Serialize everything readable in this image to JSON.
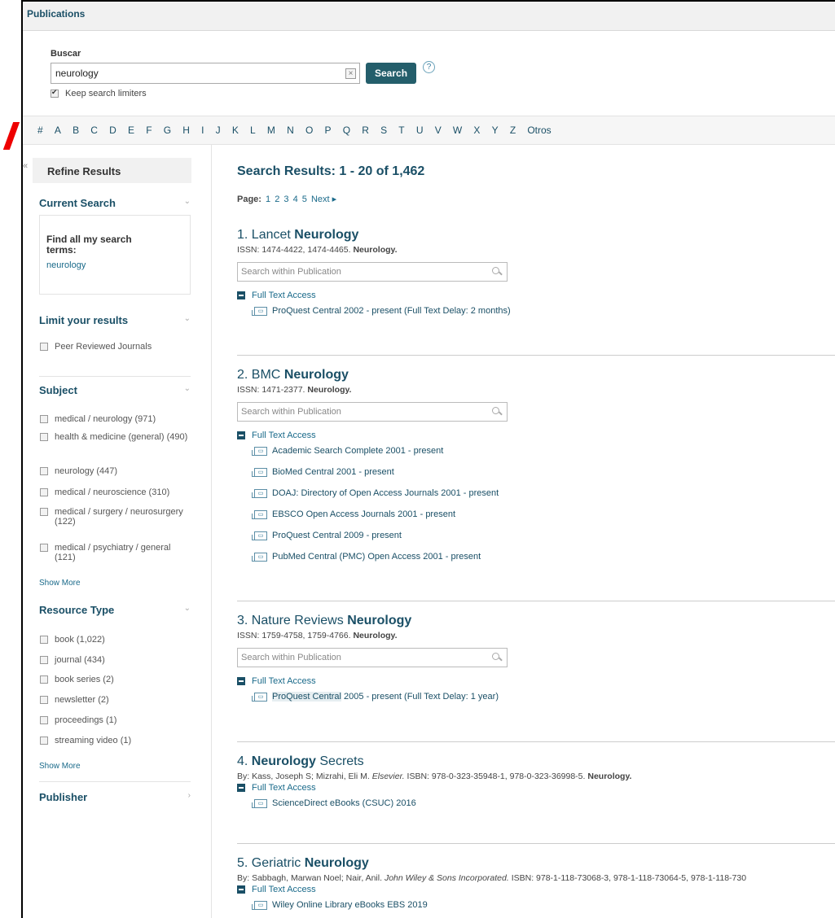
{
  "topbar": {
    "title": "Publications"
  },
  "search": {
    "label": "Buscar",
    "value": "neurology",
    "clear_glyph": "×",
    "button": "Search",
    "help": "?",
    "keep_limiters": "Keep search limiters"
  },
  "alphabet": [
    "#",
    "A",
    "B",
    "C",
    "D",
    "E",
    "F",
    "G",
    "H",
    "I",
    "J",
    "K",
    "L",
    "M",
    "N",
    "O",
    "P",
    "Q",
    "R",
    "S",
    "T",
    "U",
    "V",
    "W",
    "X",
    "Y",
    "Z",
    "Otros"
  ],
  "sidebar": {
    "collapse_glyph": "«",
    "refine_title": "Refine Results",
    "current_search": {
      "title": "Current Search",
      "box_title": "Find all my search terms:",
      "box_value": "neurology"
    },
    "limit": {
      "title": "Limit your results",
      "items": [
        "Peer Reviewed Journals"
      ]
    },
    "subject": {
      "title": "Subject",
      "items": [
        {
          "label": "medical / neurology (971)"
        },
        {
          "label": "health & medicine (general) (490)"
        },
        {
          "label": "neurology (447)"
        },
        {
          "label": "medical / neuroscience (310)"
        },
        {
          "label": "medical / surgery / neurosurgery (122)"
        },
        {
          "label": "medical / psychiatry / general (121)"
        }
      ],
      "show_more": "Show More"
    },
    "resource_type": {
      "title": "Resource Type",
      "items": [
        {
          "label": "book (1,022)"
        },
        {
          "label": "journal (434)"
        },
        {
          "label": "book series (2)"
        },
        {
          "label": "newsletter (2)"
        },
        {
          "label": "proceedings (1)"
        },
        {
          "label": "streaming video (1)"
        }
      ],
      "show_more": "Show More"
    },
    "publisher": {
      "title": "Publisher"
    }
  },
  "main": {
    "results_title": "Search Results: 1 - 20 of 1,462",
    "paging": {
      "label": "Page:",
      "pages": [
        "1",
        "2",
        "3",
        "4",
        "5"
      ],
      "next": "Next ▸"
    },
    "search_within_placeholder": "Search within Publication",
    "full_text_access": "Full Text Access",
    "results": [
      {
        "num": "1.",
        "pre": "Lancet",
        "bold": "Neurology",
        "post": "",
        "meta": "ISSN: 1474-4422, 1474-4465.",
        "meta_bold": "Neurology.",
        "links": [
          "ProQuest Central 2002 - present (Full Text Delay: 2 months)"
        ]
      },
      {
        "num": "2.",
        "pre": "BMC",
        "bold": "Neurology",
        "post": "",
        "meta": "ISSN: 1471-2377.",
        "meta_bold": "Neurology.",
        "links": [
          "Academic Search Complete 2001 - present",
          "BioMed Central 2001 - present",
          "DOAJ: Directory of Open Access Journals 2001 - present",
          "EBSCO Open Access Journals 2001 - present",
          "ProQuest Central 2009 - present",
          "PubMed Central (PMC) Open Access 2001 - present"
        ]
      },
      {
        "num": "3.",
        "pre": "Nature Reviews",
        "bold": "Neurology",
        "post": "",
        "meta": "ISSN: 1759-4758, 1759-4766.",
        "meta_bold": "Neurology.",
        "link_hl": "ProQuest Central",
        "link_rest": "2005 - present (Full Text Delay: 1 year)"
      },
      {
        "num": "4.",
        "pre": "",
        "bold": "Neurology",
        "post": "Secrets",
        "meta_by": "By: Kass, Joseph S; Mizrahi, Eli M.",
        "meta_pub": "Elsevier.",
        "meta": "ISBN: 978-0-323-35948-1, 978-0-323-36998-5.",
        "meta_bold": "Neurology.",
        "links": [
          "ScienceDirect eBooks (CSUC) 2016"
        ]
      },
      {
        "num": "5.",
        "pre": "Geriatric",
        "bold": "Neurology",
        "post": "",
        "meta_by": "By: Sabbagh, Marwan Noel; Nair, Anil.",
        "meta_pub": "John Wiley & Sons Incorporated.",
        "meta": "ISBN: 978-1-118-73068-3, 978-1-118-73064-5, 978-1-118-730",
        "links": [
          "Wiley Online Library eBooks EBS 2019"
        ]
      }
    ]
  }
}
